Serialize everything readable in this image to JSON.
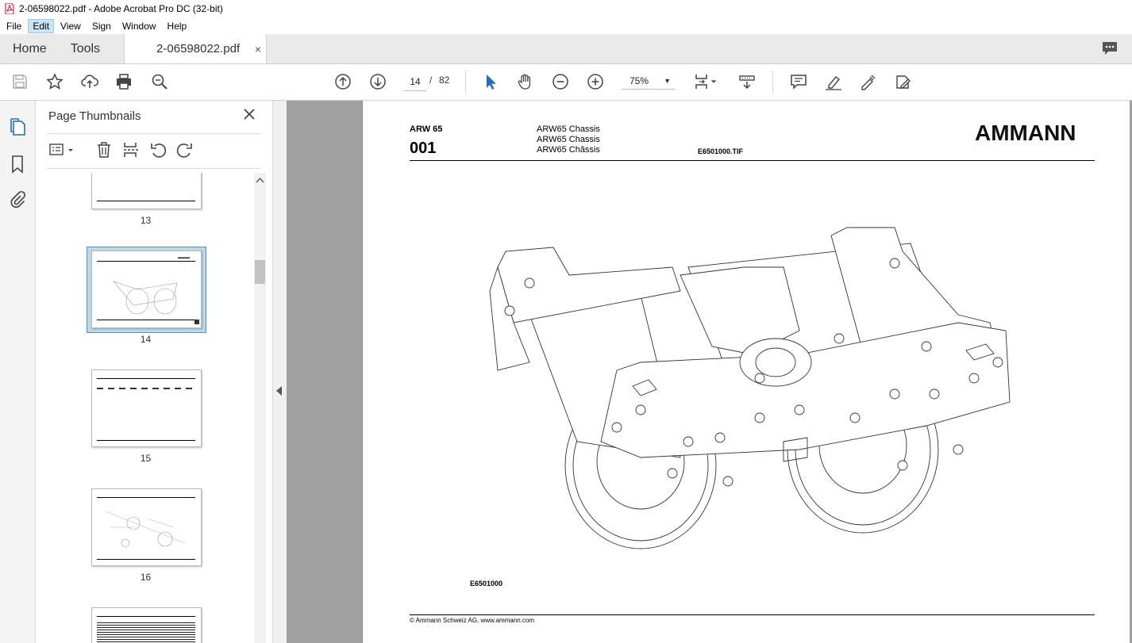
{
  "window": {
    "title": "2-06598022.pdf - Adobe Acrobat Pro DC (32-bit)"
  },
  "menu": {
    "items": [
      "File",
      "Edit",
      "View",
      "Sign",
      "Window",
      "Help"
    ],
    "active": "Edit"
  },
  "tabs": {
    "home": "Home",
    "tools": "Tools",
    "document": "2-06598022.pdf",
    "close": "×"
  },
  "toolbar": {
    "current_page": "14",
    "separator": "/",
    "total_pages": "82",
    "zoom": "75%"
  },
  "panel": {
    "title": "Page Thumbnails",
    "thumbnails": [
      {
        "label": "13"
      },
      {
        "label": "14",
        "selected": true
      },
      {
        "label": "15"
      },
      {
        "label": "16"
      },
      {
        "label": ""
      }
    ]
  },
  "document_page": {
    "model": "ARW 65",
    "number": "001",
    "descriptions": [
      "ARW65 Chassis",
      "ARW65 Chassis",
      "ARW65 Châssis"
    ],
    "file": "E6501000.TIF",
    "brand": "AMMANN",
    "figure_label": "E6501000",
    "copyright": "© Ammann Schweiz AG, www.ammann.com"
  },
  "colors": {
    "tab_bar": "#e9e9e9",
    "viewer_bg": "#a0a0a0",
    "selection": "#bcd8ea",
    "icon_blue": "#1f6fb5",
    "menu_active": "#cce4f7"
  }
}
